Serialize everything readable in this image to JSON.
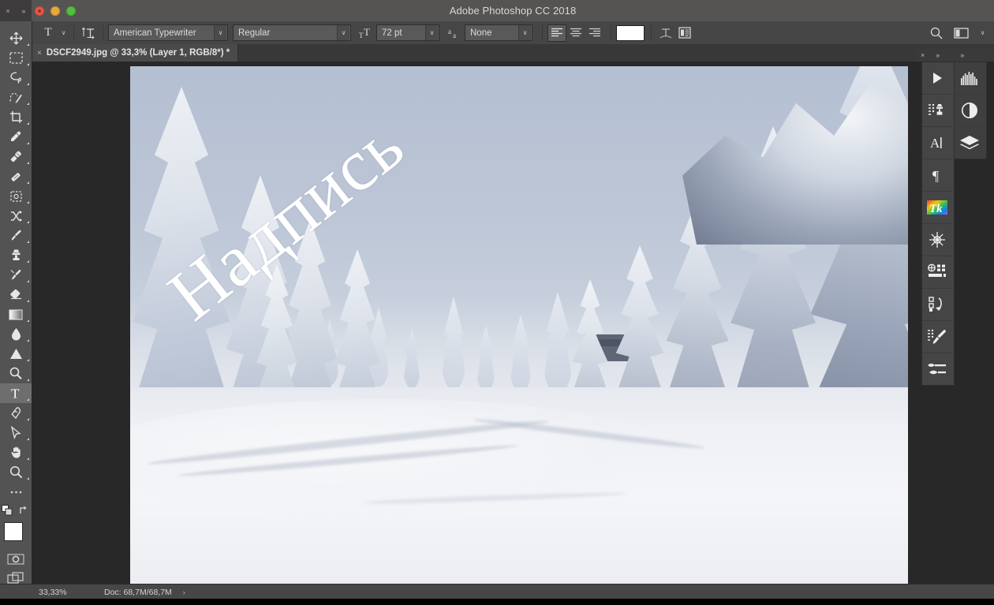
{
  "window": {
    "title": "Adobe Photoshop CC 2018",
    "traffic_lights": [
      "close",
      "minimize",
      "zoom"
    ]
  },
  "toolbar_header": {
    "close": "×",
    "expand": "»"
  },
  "options_bar": {
    "tool_icon": "T",
    "tool_preset_caret": "∨",
    "orientation_icon": "text-orientation-icon",
    "font_family": "American Typewriter",
    "font_style": "Regular",
    "font_size": "72 pt",
    "antialias_icon": "aa",
    "antialias": "None",
    "align_left": "align-left-icon",
    "align_center": "align-center-icon",
    "align_right": "align-right-icon",
    "color_swatch": "#ffffff",
    "warp_text": "warp-text-icon",
    "char_paragraph_panels": "character-paragraph-panels-icon",
    "search": "search-icon",
    "workspace": "workspace-switcher-icon",
    "workspace_caret": "∨",
    "dropdown_caret": "∨"
  },
  "document_tab": {
    "close": "×",
    "label": "DSCF2949.jpg @ 33,3% (Layer 1, RGB/8*) *"
  },
  "tools": [
    {
      "name": "move-tool",
      "icon": "move"
    },
    {
      "name": "rectangular-marquee-tool",
      "icon": "marquee"
    },
    {
      "name": "lasso-tool",
      "icon": "lasso"
    },
    {
      "name": "quick-selection-tool",
      "icon": "quickselect"
    },
    {
      "name": "crop-tool",
      "icon": "crop"
    },
    {
      "name": "eyedropper-tool",
      "icon": "eyedropper"
    },
    {
      "name": "spot-healing-brush-tool",
      "icon": "healing"
    },
    {
      "name": "patch-tool",
      "icon": "patch"
    },
    {
      "name": "frame-tool",
      "icon": "frame"
    },
    {
      "name": "shuffle-tool",
      "icon": "shuffle"
    },
    {
      "name": "brush-tool",
      "icon": "brush"
    },
    {
      "name": "clone-stamp-tool",
      "icon": "stamp"
    },
    {
      "name": "history-brush-tool",
      "icon": "historybrush"
    },
    {
      "name": "eraser-tool",
      "icon": "eraser"
    },
    {
      "name": "gradient-tool",
      "icon": "gradient"
    },
    {
      "name": "blur-tool",
      "icon": "blur"
    },
    {
      "name": "dodge-tool",
      "icon": "dodge"
    },
    {
      "name": "sponge-tool",
      "icon": "sponge"
    },
    {
      "name": "type-tool",
      "icon": "type",
      "active": true
    },
    {
      "name": "pen-tool",
      "icon": "pen"
    },
    {
      "name": "path-selection-tool",
      "icon": "pathselect"
    },
    {
      "name": "hand-tool",
      "icon": "hand"
    },
    {
      "name": "zoom-tool",
      "icon": "zoom"
    },
    {
      "name": "edit-toolbar-button",
      "icon": "ellipsis"
    }
  ],
  "tool_footer": {
    "default_colors_icon": "default-colors-icon",
    "swap_colors_icon": "swap-colors-icon",
    "foreground_color": "#ffffff",
    "background_color": "#f2f2f2",
    "quick_mask_icon": "quick-mask-icon",
    "screen_mode_icon": "screen-mode-icon"
  },
  "panel_dock": {
    "close": "×",
    "expand_left": "»",
    "expand_right": "»",
    "column_a": [
      {
        "name": "actions-panel-icon",
        "icon": "play"
      },
      {
        "name": "clone-source-panel-icon",
        "icon": "clonesource"
      },
      {
        "name": "character-panel-icon",
        "icon": "character"
      },
      {
        "name": "paragraph-panel-icon",
        "icon": "paragraph"
      },
      {
        "name": "tk-panel-icon",
        "icon": "tk"
      },
      {
        "name": "effects-panel-icon",
        "icon": "snowflake"
      },
      {
        "name": "properties-panel-icon",
        "icon": "properties"
      },
      {
        "name": "history-panel-icon",
        "icon": "history"
      },
      {
        "name": "brush-presets-panel-icon",
        "icon": "brushpresets"
      },
      {
        "name": "brush-settings-panel-icon",
        "icon": "brushsettings"
      }
    ],
    "column_b": [
      {
        "name": "histogram-panel-icon",
        "icon": "histogram"
      },
      {
        "name": "adjustments-panel-icon",
        "icon": "adjustments"
      },
      {
        "name": "layers-panel-icon",
        "icon": "layers"
      }
    ]
  },
  "canvas": {
    "text_layer_content": "Надпись",
    "text_color": "#ffffff",
    "text_rotation_deg": -38,
    "image_subject": "snow-covered-spruce-forest"
  },
  "status_bar": {
    "zoom": "33,33%",
    "doc_info": "Doc: 68,7M/68,7M",
    "arrow": "›"
  }
}
